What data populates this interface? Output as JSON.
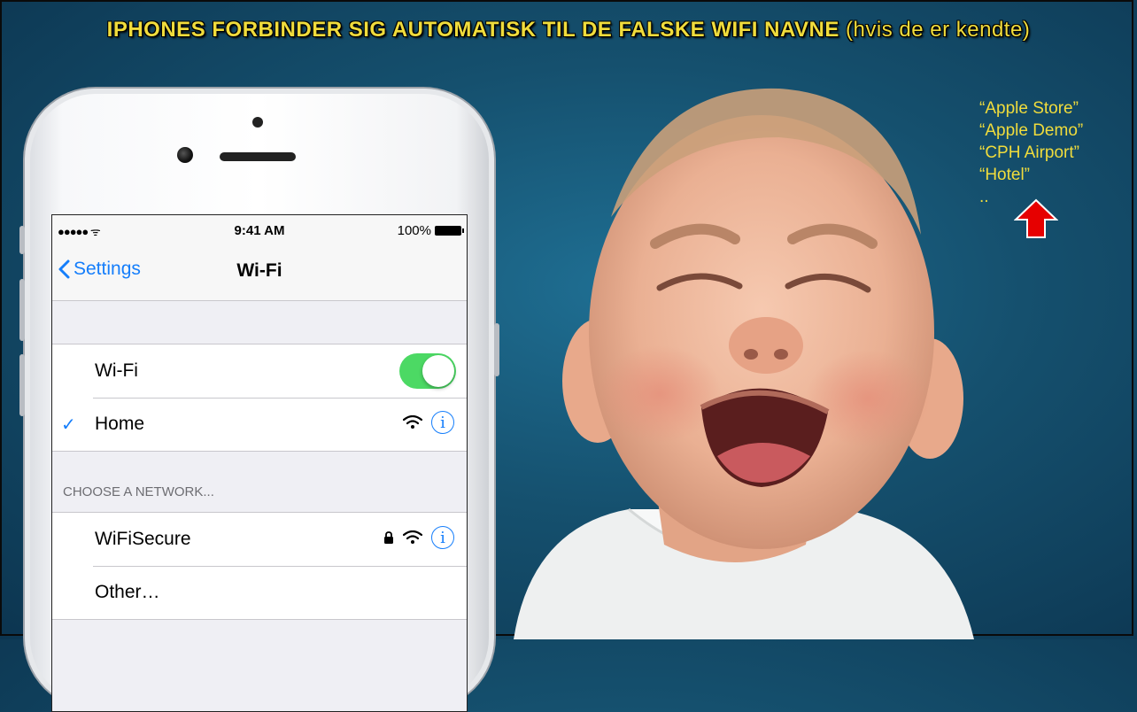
{
  "title": {
    "main": "IPHONES FORBINDER SIG AUTOMATISK TIL DE FALSKE WIFI NAVNE",
    "sub": "(hvis de er kendte)"
  },
  "status_bar": {
    "signal": "●●●●● ᯤ",
    "time": "9:41 AM",
    "battery": "100%"
  },
  "nav": {
    "back_label": "Settings",
    "title": "Wi-Fi"
  },
  "wifi_group": {
    "toggle_label": "Wi-Fi",
    "toggle_on": true,
    "connected_network": "Home"
  },
  "choose_section": {
    "header": "CHOOSE A NETWORK...",
    "networks": [
      {
        "name": "WiFiSecure",
        "locked": true
      },
      {
        "name": "Other…"
      }
    ]
  },
  "fake_wifi_names": [
    "“Apple Store”",
    "“Apple Demo”",
    "“CPH Airport”",
    "“Hotel”",
    ".."
  ],
  "icons": {
    "back": "chevron-left-icon",
    "check": "checkmark-icon",
    "wifi": "wifi-icon",
    "info": "info-icon",
    "lock": "lock-icon",
    "arrow": "up-arrow-icon"
  },
  "colors": {
    "title": "#f0dc3c",
    "ios_blue": "#157efb",
    "toggle_on": "#4cd964",
    "arrow": "#e60000"
  }
}
